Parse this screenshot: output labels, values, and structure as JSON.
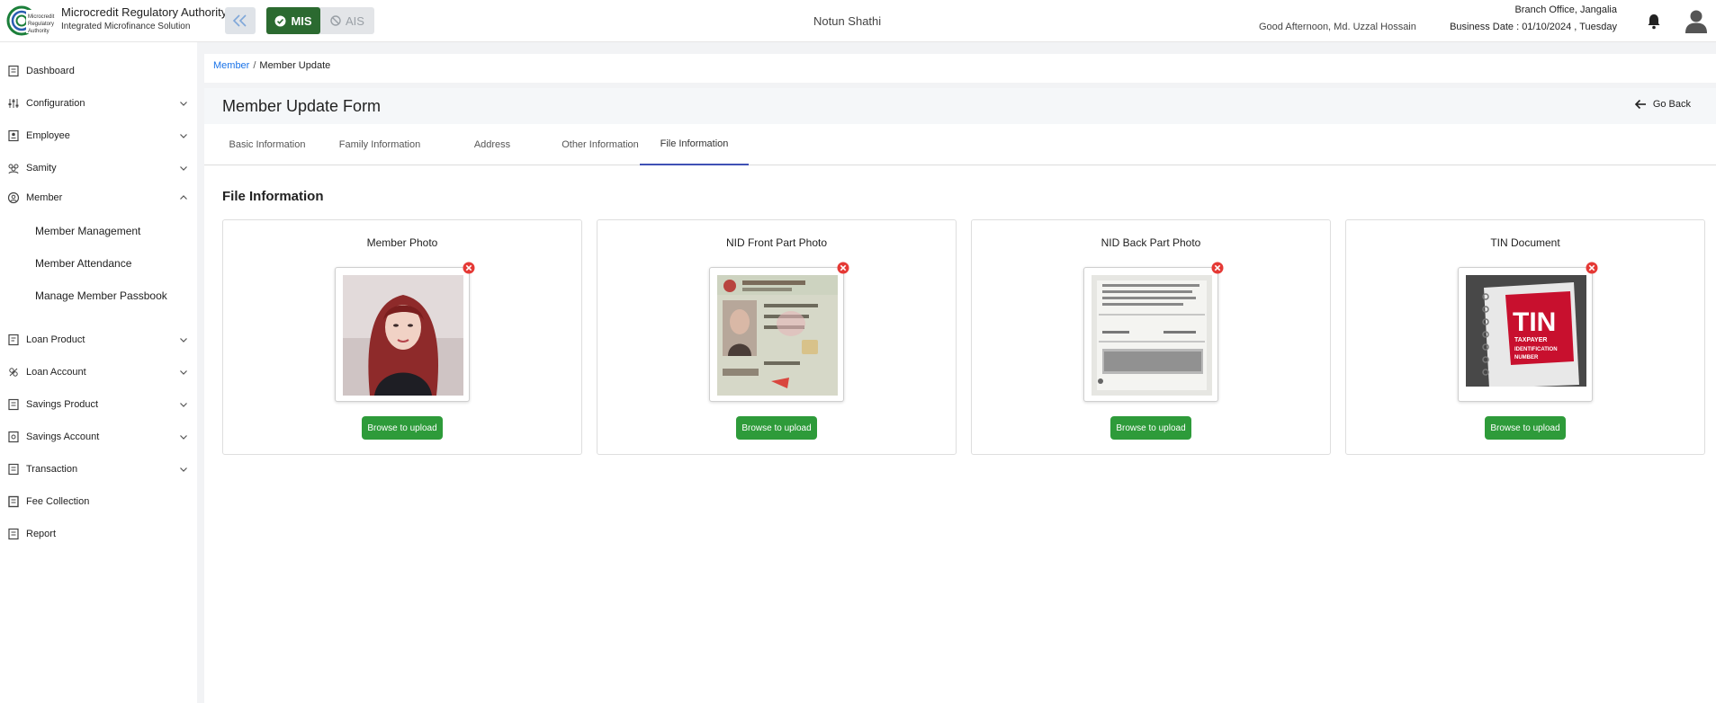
{
  "header": {
    "org_title": "Microcredit Regulatory Authority",
    "org_subtitle": "Integrated Microfinance Solution",
    "logo_text": "Microcredit Regulatory Authority",
    "mode_mis": "MIS",
    "mode_ais": "AIS",
    "app_name": "Notun Shathi",
    "greeting": "Good Afternoon, Md. Uzzal Hossain",
    "branch": "Branch Office, Jangalia",
    "business_date": "Business Date : 01/10/2024 , Tuesday"
  },
  "sidebar": {
    "items": [
      {
        "label": "Dashboard"
      },
      {
        "label": "Configuration"
      },
      {
        "label": "Employee"
      },
      {
        "label": "Samity"
      },
      {
        "label": "Member"
      },
      {
        "label": "Loan Product"
      },
      {
        "label": "Loan Account"
      },
      {
        "label": "Savings Product"
      },
      {
        "label": "Savings Account"
      },
      {
        "label": "Transaction"
      },
      {
        "label": "Fee Collection"
      },
      {
        "label": "Report"
      }
    ],
    "member_sub": [
      {
        "label": "Member Management"
      },
      {
        "label": "Member Attendance"
      },
      {
        "label": "Manage Member Passbook"
      }
    ]
  },
  "breadcrumb": {
    "parent": "Member",
    "separator": "/",
    "current": "Member Update"
  },
  "form": {
    "title": "Member Update Form",
    "go_back": "Go Back"
  },
  "tabs": [
    {
      "label": "Basic Information"
    },
    {
      "label": "Family Information"
    },
    {
      "label": "Address"
    },
    {
      "label": "Other Information"
    },
    {
      "label": "File Information"
    }
  ],
  "section": {
    "title": "File Information"
  },
  "files": [
    {
      "title": "Member Photo",
      "button": "Browse to upload"
    },
    {
      "title": "NID Front Part Photo",
      "button": "Browse to upload"
    },
    {
      "title": "NID Back Part Photo",
      "button": "Browse to upload"
    },
    {
      "title": "TIN Document",
      "button": "Browse to upload",
      "tin_text": "TIN",
      "tin_lines": [
        "TAXPAYER",
        "IDENTIFICATION",
        "NUMBER"
      ]
    }
  ],
  "colors": {
    "accent": "#1a73e8",
    "tab_active": "#3f51b5",
    "mis_active": "#2b6a30",
    "upload_button": "#2e9b3a",
    "delete": "#e53935"
  }
}
